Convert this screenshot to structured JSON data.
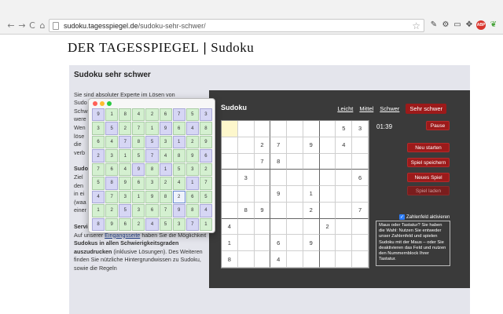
{
  "browser": {
    "url_host": "sudoku.tagesspiegel.de",
    "url_path": "/sudoku-sehr-schwer/",
    "back_glyph": "←",
    "forward_glyph": "→",
    "reload_glyph": "C",
    "home_glyph": "⌂",
    "star_glyph": "☆",
    "extension_icons": [
      "eyedropper-icon",
      "gear-icon",
      "cast-icon",
      "move-icon",
      "adblock-icon",
      "evernote-icon"
    ]
  },
  "site": {
    "logo": "DER TAGESSPIEGEL",
    "separator": "|",
    "section": "Sudoku"
  },
  "article": {
    "title": "Sudoku sehr schwer",
    "lines": [
      "Sie sind absoluter Experte im Lösen von",
      "Sudo",
      "Schw",
      "were",
      "Wen",
      "löse",
      "die",
      "verb"
    ],
    "lines2": [
      "Sudo",
      "Ziel",
      "den",
      "in ei",
      "(waa",
      "einer"
    ],
    "service_heading": "Service",
    "service_text_1": "Auf unserer",
    "service_link": "Eingangsseite",
    "service_text_2": "haben Sie die",
    "service_text_3": "Möglichkeit",
    "service_bold": "Sudokus in allen Schwierigkeitsgraden auszudrucken",
    "service_text_4": "(inklusive",
    "service_text_5": "Lösungen). Des Weiteren finden Sie nützliche",
    "service_text_6": "Hintergrundwissen zu Sudoku, sowie die Regeln"
  },
  "sudoku": {
    "title": "Sudoku",
    "levels": [
      "Leicht",
      "Mittel",
      "Schwer"
    ],
    "active_level": "Sehr schwer",
    "timer": "01:39",
    "pause_label": "Pause",
    "buttons": [
      "Neu starten",
      "Spiel speichern",
      "Neues Spiel"
    ],
    "disabled_button": "Spiel laden",
    "checkbox_label": "Zahlenfeld aktivieren",
    "checkbox_glyph": "✓",
    "hint_text": "Maus oder Tastatur? Sie haben die Wahl: Nutzen Sie entweder unser Zahlenfeld und spielen Sudoku mit der Maus – oder Sie deaktivieren das Feld und nutzen den Nummernblock Ihrer Tastatur.",
    "grid": [
      [
        "",
        "",
        "",
        "",
        "",
        "",
        "",
        "5",
        "3"
      ],
      [
        "",
        "",
        "2",
        "7",
        "",
        "9",
        "",
        "4",
        ""
      ],
      [
        "",
        "",
        "7",
        "8",
        "",
        "",
        "",
        "",
        ""
      ],
      [
        "",
        "3",
        "",
        "",
        "",
        "",
        "",
        "",
        "6"
      ],
      [
        "",
        "",
        "",
        "9",
        "",
        "1",
        "",
        "",
        ""
      ],
      [
        "",
        "8",
        "9",
        "",
        "",
        "2",
        "",
        "",
        "7"
      ],
      [
        "4",
        "",
        "",
        "",
        "",
        "",
        "2",
        "",
        ""
      ],
      [
        "1",
        "",
        "",
        "6",
        "",
        "9",
        "",
        "",
        ""
      ],
      [
        "8",
        "",
        "",
        "4",
        "",
        "",
        "",
        "",
        ""
      ]
    ],
    "highlight_cell": [
      0,
      0
    ]
  },
  "popup": {
    "grid": [
      [
        "9",
        "1",
        "8",
        "4",
        "2",
        "6",
        "7",
        "5",
        "3"
      ],
      [
        "3",
        "5",
        "2",
        "7",
        "1",
        "9",
        "6",
        "4",
        "8"
      ],
      [
        "6",
        "4",
        "7",
        "8",
        "5",
        "3",
        "1",
        "2",
        "9"
      ],
      [
        "2",
        "3",
        "1",
        "5",
        "7",
        "4",
        "8",
        "9",
        "6"
      ],
      [
        "7",
        "6",
        "4",
        "9",
        "8",
        "1",
        "5",
        "3",
        "2"
      ],
      [
        "5",
        "8",
        "9",
        "6",
        "3",
        "2",
        "4",
        "1",
        "7"
      ],
      [
        "4",
        "7",
        "3",
        "1",
        "9",
        "8",
        "2",
        "6",
        "5"
      ],
      [
        "1",
        "2",
        "5",
        "3",
        "6",
        "7",
        "9",
        "8",
        "4"
      ],
      [
        "8",
        "9",
        "6",
        "2",
        "4",
        "5",
        "3",
        "7",
        "1"
      ]
    ],
    "blue_cells": [
      [
        0,
        0
      ],
      [
        0,
        6
      ],
      [
        0,
        8
      ],
      [
        1,
        1
      ],
      [
        1,
        5
      ],
      [
        1,
        7
      ],
      [
        2,
        2
      ],
      [
        2,
        4
      ],
      [
        2,
        6
      ],
      [
        3,
        0
      ],
      [
        3,
        4
      ],
      [
        3,
        8
      ],
      [
        4,
        3
      ],
      [
        4,
        5
      ],
      [
        5,
        1
      ],
      [
        5,
        7
      ],
      [
        6,
        0
      ],
      [
        6,
        6
      ],
      [
        7,
        2
      ],
      [
        7,
        6
      ],
      [
        7,
        8
      ],
      [
        8,
        0
      ],
      [
        8,
        4
      ],
      [
        8,
        7
      ]
    ],
    "selected_cell": [
      6,
      6
    ],
    "traffic_colors": [
      "#ff5f57",
      "#febc2e",
      "#28c840"
    ]
  }
}
